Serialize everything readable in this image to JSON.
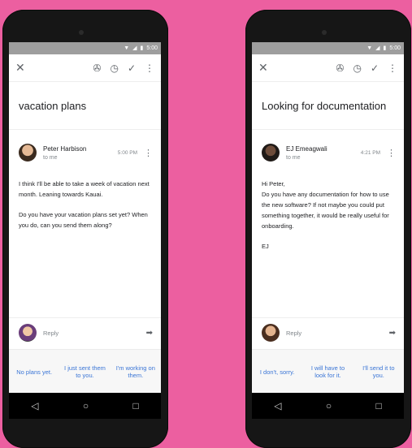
{
  "status_bar": {
    "time": "5:00",
    "wifi_icon": "wifi-icon",
    "signal_icon": "signal-icon",
    "battery_icon": "battery-icon"
  },
  "toolbar_icons": [
    "close-icon",
    "pin-icon",
    "snooze-clock-icon",
    "done-check-icon",
    "more-vert-icon"
  ],
  "nav_icons": [
    "back-icon",
    "home-icon",
    "recents-icon"
  ],
  "accent_color": "#3a75d6",
  "background_color": "#ec5fa0",
  "left": {
    "subject": "vacation plans",
    "sender": "Peter Harbison",
    "to": "to me",
    "time": "5:00 PM",
    "body": [
      "I think I'll be able to take a week of vacation next month. Leaning towards Kauai.",
      "Do you have your vacation plans set yet? When you do, can you send them along?"
    ],
    "reply_placeholder": "Reply",
    "smart_replies": [
      "No plans yet.",
      "I just sent them to you.",
      "I'm working on them."
    ]
  },
  "right": {
    "status_time": "5:00",
    "subject": "Looking for documentation",
    "sender": "EJ Emeagwali",
    "to": "to me",
    "time": "4:21 PM",
    "body": [
      "Hi Peter,",
      "Do you have any documentation for how to use the new software? If not maybe you could put something together, it would be really useful for onboarding.",
      "EJ"
    ],
    "reply_placeholder": "Reply",
    "smart_replies": [
      "I don't, sorry.",
      "I will have to look for it.",
      "I'll send it to you."
    ]
  }
}
